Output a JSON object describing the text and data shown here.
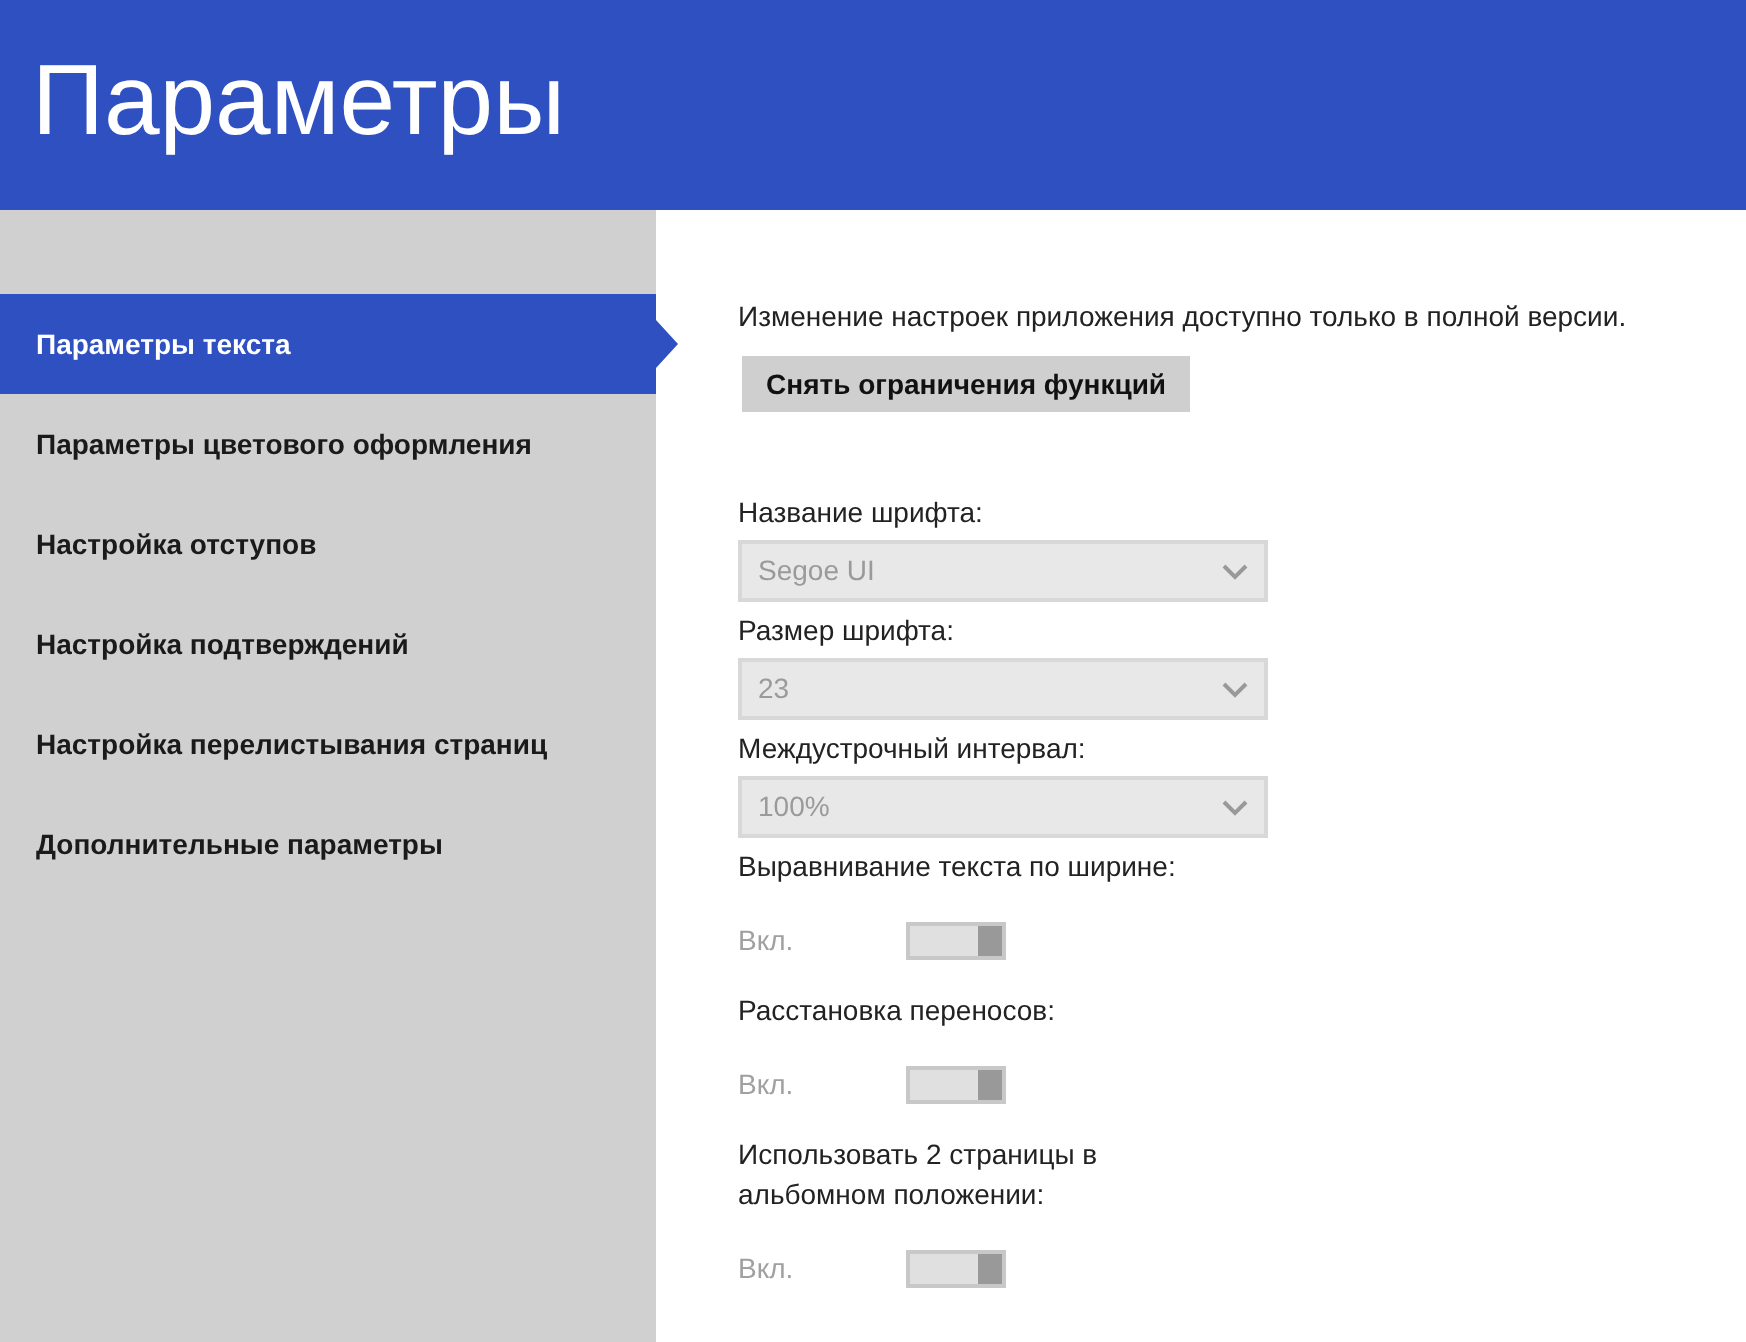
{
  "header": {
    "title": "Параметры"
  },
  "sidebar": {
    "items": [
      {
        "label": "Параметры текста",
        "selected": true
      },
      {
        "label": "Параметры цветового оформления",
        "selected": false
      },
      {
        "label": "Настройка отступов",
        "selected": false
      },
      {
        "label": "Настройка подтверждений",
        "selected": false
      },
      {
        "label": "Настройка перелистывания страниц",
        "selected": false
      },
      {
        "label": "Дополнительные параметры",
        "selected": false
      }
    ]
  },
  "notice": "Изменение настроек приложения доступно только в полной версии.",
  "unlock_button": "Снять ограничения функций",
  "settings": [
    {
      "kind": "dropdown",
      "label": "Название шрифта:",
      "value": "Segoe UI",
      "disabled": true
    },
    {
      "kind": "dropdown",
      "label": "Размер шрифта:",
      "value": "23",
      "disabled": true
    },
    {
      "kind": "dropdown",
      "label": "Междустрочный интервал:",
      "value": "100%",
      "disabled": true
    },
    {
      "kind": "toggle",
      "label": "Выравнивание текста по ширине:",
      "state_text": "Вкл.",
      "on": true,
      "disabled": true
    },
    {
      "kind": "toggle",
      "label": "Расстановка переносов:",
      "state_text": "Вкл.",
      "on": true,
      "disabled": true
    },
    {
      "kind": "toggle",
      "label": "Использовать 2 страницы в альбомном положении:",
      "state_text": "Вкл.",
      "on": true,
      "disabled": true
    }
  ]
}
